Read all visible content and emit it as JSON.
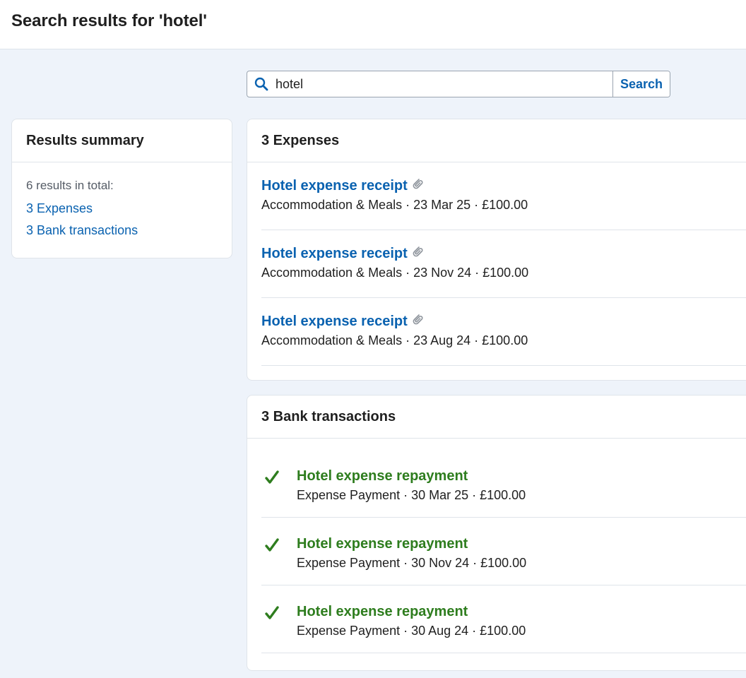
{
  "header": {
    "title": "Search results for 'hotel'"
  },
  "search": {
    "value": "hotel",
    "button_label": "Search"
  },
  "summary": {
    "title": "Results summary",
    "total_text": "6 results in total:",
    "links": [
      "3 Expenses",
      "3 Bank transactions"
    ]
  },
  "expenses": {
    "title": "3 Expenses",
    "items": [
      {
        "title": "Hotel expense receipt",
        "meta": "Accommodation & Meals · 23 Mar 25 · £100.00"
      },
      {
        "title": "Hotel expense receipt",
        "meta": "Accommodation & Meals · 23 Nov 24 · £100.00"
      },
      {
        "title": "Hotel expense receipt",
        "meta": "Accommodation & Meals · 23 Aug 24 · £100.00"
      }
    ]
  },
  "bank": {
    "title": "3 Bank transactions",
    "items": [
      {
        "title": "Hotel expense repayment",
        "meta": "Expense Payment · 30 Mar 25 · £100.00"
      },
      {
        "title": "Hotel expense repayment",
        "meta": "Expense Payment · 30 Nov 24 · £100.00"
      },
      {
        "title": "Hotel expense repayment",
        "meta": "Expense Payment · 30 Aug 24 · £100.00"
      }
    ]
  },
  "colors": {
    "link": "#0a62b0",
    "success": "#2e7d1e",
    "background": "#eef3fa"
  },
  "icons": {
    "search": "search-icon",
    "attachment": "paperclip-icon",
    "reconciled": "checkmark-icon"
  }
}
